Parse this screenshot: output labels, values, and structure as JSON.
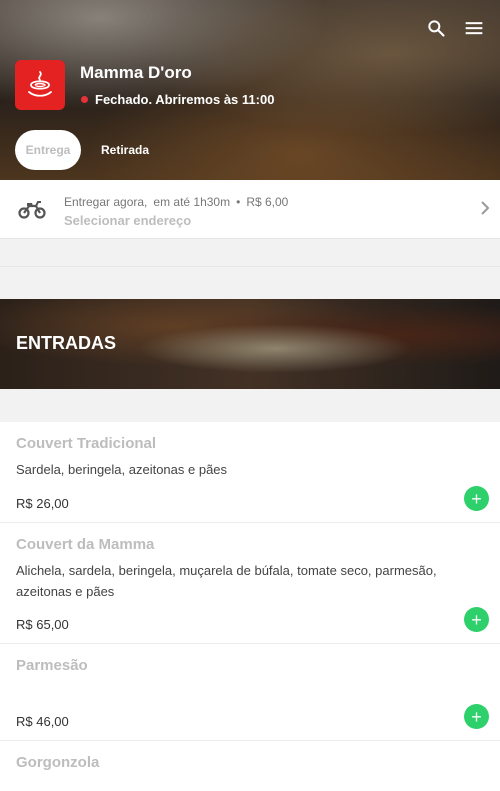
{
  "store": {
    "name": "Mamma D'oro",
    "status": "Fechado. Abriremos às 11:00",
    "status_color": "#e8323a",
    "logo_color": "#e52222"
  },
  "header_icons": [
    "search-icon",
    "menu-icon"
  ],
  "tabs": [
    {
      "label": "Entrega",
      "active": true
    },
    {
      "label": "Retirada",
      "active": false
    }
  ],
  "delivery": {
    "mode": "Entregar agora,",
    "eta": "em até 1h30m",
    "separator": "•",
    "fee": "R$ 6,00",
    "address_prompt": "Selecionar endereço"
  },
  "category": {
    "title": "ENTRADAS"
  },
  "items": [
    {
      "name": "Couvert Tradicional",
      "description": "Sardela, beringela, azeitonas e pães",
      "price": "R$ 26,00"
    },
    {
      "name": "Couvert da Mamma",
      "description": "Alichela, sardela, beringela, muçarela de búfala, tomate seco, parmesão, azeitonas e pães",
      "price": "R$ 65,00"
    },
    {
      "name": "Parmesão",
      "description": "",
      "price": "R$ 46,00"
    },
    {
      "name": "Gorgonzola",
      "description": "",
      "price": ""
    }
  ],
  "add_button_label": "+",
  "accent_color": "#2ed06b"
}
